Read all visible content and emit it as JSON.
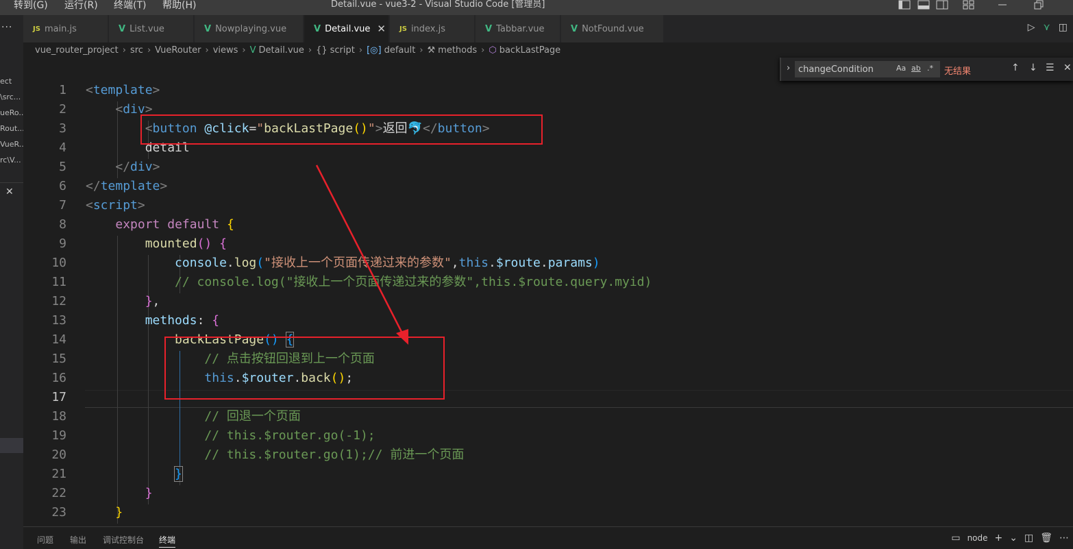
{
  "titlebar": {
    "menus": [
      "转到(G)",
      "运行(R)",
      "终端(T)",
      "帮助(H)"
    ],
    "title": "Detail.vue - vue3-2 - Visual Studio Code [管理员]"
  },
  "sidebar_fragments": [
    "ect",
    "\\src...",
    "ueRo...",
    "Rout...",
    "VueR...",
    "rc\\V..."
  ],
  "tabs": [
    {
      "icon": "JS",
      "label": "main.js"
    },
    {
      "icon": "V",
      "label": "List.vue"
    },
    {
      "icon": "V",
      "label": "Nowplaying.vue"
    },
    {
      "icon": "V",
      "label": "Detail.vue"
    },
    {
      "icon": "JS",
      "label": "index.js"
    },
    {
      "icon": "V",
      "label": "Tabbar.vue"
    },
    {
      "icon": "V",
      "label": "NotFound.vue"
    }
  ],
  "breadcrumb": [
    "vue_router_project",
    "src",
    "VueRouter",
    "views",
    "Detail.vue",
    "script",
    "default",
    "methods",
    "backLastPage"
  ],
  "find": {
    "value": "changeCondition",
    "opt_case": "Aa",
    "opt_word": "ab",
    "opt_regex": ".*",
    "result": "无结果"
  },
  "line_numbers": [
    "1",
    "2",
    "3",
    "4",
    "5",
    "6",
    "7",
    "8",
    "9",
    "10",
    "11",
    "12",
    "13",
    "14",
    "15",
    "16",
    "17",
    "18",
    "19",
    "20",
    "21",
    "22",
    "23"
  ],
  "code": {
    "l1": {
      "lt": "<",
      "tag": "template",
      "gt": ">"
    },
    "l2": {
      "lt": "<",
      "tag": "div",
      "gt": ">"
    },
    "l3": {
      "lt": "<",
      "tag": "button",
      "attr": "@click",
      "eq": "=",
      "q1": "\"",
      "handler": "backLastPage",
      "paren": "()",
      "q2": "\"",
      "gt": ">",
      "text": "返回",
      "emoji": "🐬",
      "close_lt": "</",
      "close_tag": "button",
      "close_gt": ">"
    },
    "l4": {
      "text": "detail"
    },
    "l5": {
      "lt": "</",
      "tag": "div",
      "gt": ">"
    },
    "l6": {
      "lt": "</",
      "tag": "template",
      "gt": ">"
    },
    "l7": {
      "lt": "<",
      "tag": "script",
      "gt": ">"
    },
    "l8": {
      "kw1": "export",
      "kw2": "default",
      "brace": "{"
    },
    "l9": {
      "fn": "mounted",
      "paren": "()",
      "brace": "{"
    },
    "l10": {
      "obj": "console",
      "dot": ".",
      "fn": "log",
      "open": "(",
      "str": "\"接收上一个页面传递过来的参数\"",
      "comma": ",",
      "this": "this",
      "dot2": ".",
      "prop": "$route",
      "dot3": ".",
      "prop2": "params",
      "close": ")"
    },
    "l11": {
      "comment": "// console.log(\"接收上一个页面传递过来的参数\",this.$route.query.myid)"
    },
    "l12": {
      "brace": "}",
      "comma": ","
    },
    "l13": {
      "prop": "methods",
      "colon": ":",
      "brace": "{"
    },
    "l14": {
      "fn": "backLastPage",
      "paren": "()",
      "brace": "{"
    },
    "l15": {
      "comment": "// 点击按钮回退到上一个页面"
    },
    "l16": {
      "this": "this",
      "dot": ".",
      "prop": "$router",
      "dot2": ".",
      "fn": "back",
      "paren": "()",
      "semi": ";"
    },
    "l18": {
      "comment": "// 回退一个页面"
    },
    "l19": {
      "comment": "// this.$router.go(-1);"
    },
    "l20": {
      "comment": "// this.$router.go(1);// 前进一个页面"
    },
    "l21": {
      "brace": "}"
    },
    "l22": {
      "brace": "}"
    },
    "l23": {
      "brace": "}"
    }
  },
  "panel": {
    "tabs": [
      "问题",
      "输出",
      "调试控制台",
      "终端"
    ],
    "terminal_name": "node"
  },
  "colors": {
    "annotation": "#e8212b",
    "background": "#1e1e1e"
  },
  "icons": {
    "tab_js": "JS",
    "tab_vue": "V",
    "close": "✕"
  }
}
